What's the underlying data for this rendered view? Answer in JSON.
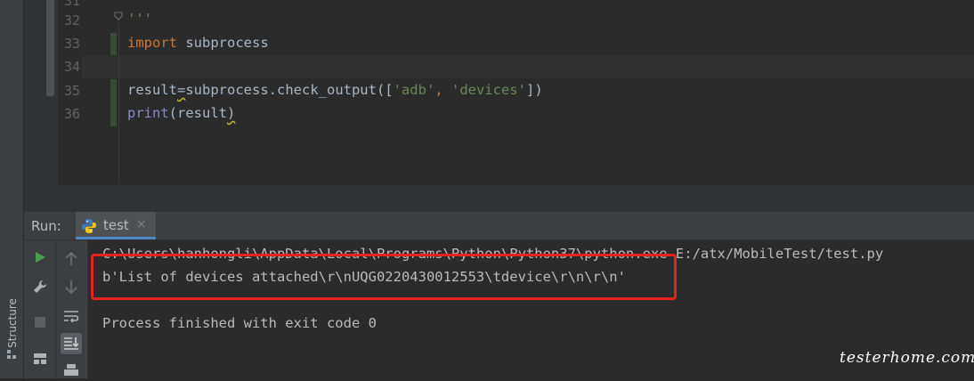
{
  "editor": {
    "lines": [
      {
        "no": "31",
        "text": ""
      },
      {
        "no": "32",
        "text": "'''"
      },
      {
        "no": "33",
        "keyword": "import",
        "rest": " subprocess"
      },
      {
        "no": "34",
        "text": ""
      },
      {
        "no": "35",
        "pre": "result",
        "op": "=",
        "call": "subprocess.check_output([",
        "s1": "'adb'",
        "sep": ", ",
        "s2": "'devices'",
        "post": "])"
      },
      {
        "no": "36",
        "builtin": "print",
        "args_open": "(result",
        "args_close": ")"
      }
    ]
  },
  "sidebar": {
    "structure_label": "Structure"
  },
  "run_panel": {
    "label": "Run:",
    "tab": {
      "label": "test",
      "close": "×",
      "icon": "python-icon"
    },
    "console": [
      "C:\\Users\\hanhongli\\AppData\\Local\\Programs\\Python\\Python37\\python.exe E:/atx/MobileTest/test.py",
      "b'List of devices attached\\r\\nUQG0220430012553\\tdevice\\r\\n\\r\\n'",
      "",
      "Process finished with exit code 0"
    ]
  },
  "watermark": "testerhome.com",
  "colors": {
    "highlight": "#e8231d",
    "run_green": "#499c54",
    "keyword": "#cc7832",
    "string": "#6a8759"
  }
}
